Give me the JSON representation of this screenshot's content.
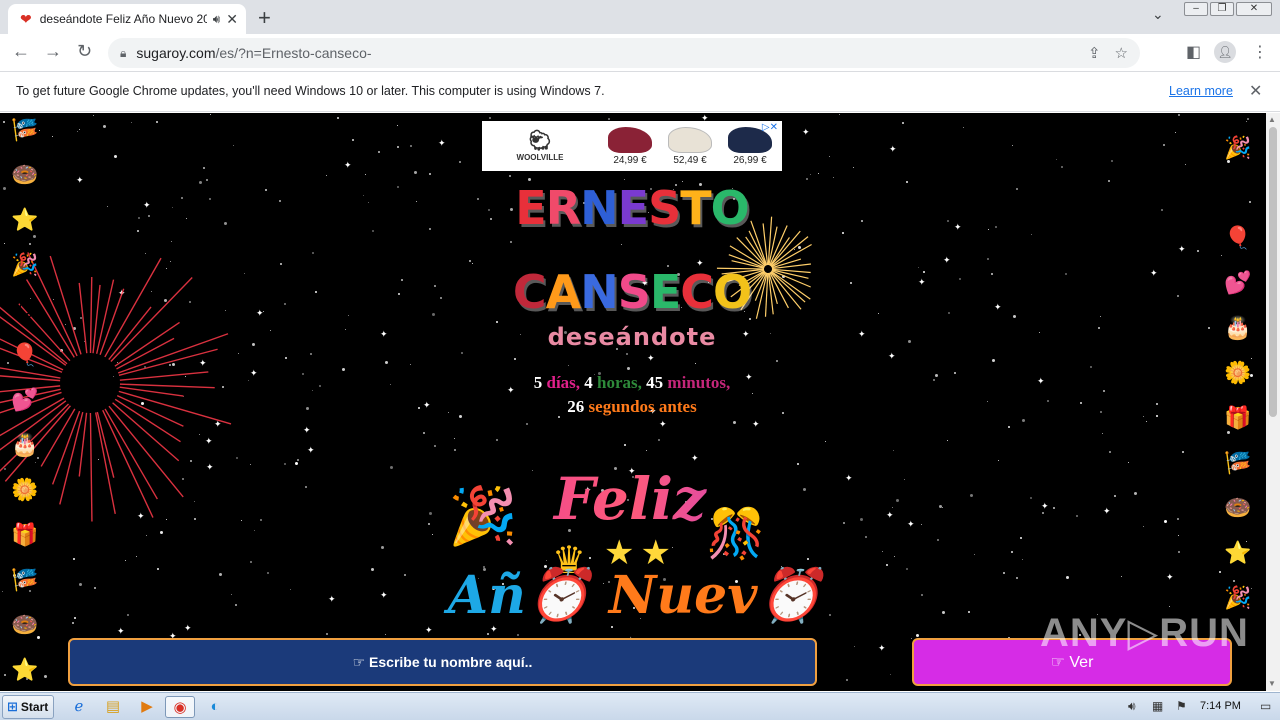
{
  "browser": {
    "tab_title": "deseándote Feliz Año Nuevo 20",
    "new_tab": "+",
    "url_host": "sugaroy.com",
    "url_path": "/es/?n=Ernesto-canseco-"
  },
  "infobar": {
    "message": "To get future Google Chrome updates, you'll need Windows 10 or later. This computer is using Windows 7.",
    "link": "Learn more"
  },
  "ad": {
    "brand": "WOOLVILLE",
    "prices": [
      "24,99 €",
      "52,49 €",
      "26,99 €"
    ]
  },
  "greeting": {
    "first_name_letters": [
      "E",
      "R",
      "N",
      "E",
      "S",
      "T",
      "O"
    ],
    "last_name_letters": [
      "C",
      "A",
      "N",
      "S",
      "E",
      "C",
      "O"
    ],
    "wishing": "deseándote",
    "countdown": {
      "days_value": "5",
      "days_label": "días,",
      "hours_value": "4",
      "hours_label": "horas,",
      "minutes_value": "45",
      "minutes_label": "minutos,",
      "seconds_value": "26",
      "seconds_label": "segundos antes"
    },
    "banner_line1": "Feliz",
    "banner_line2_a": "Añ",
    "banner_line2_b": "Nuev"
  },
  "cta": {
    "input_label": "☞ Escribe tu nombre aquí..",
    "button_label": "☞ Ver"
  },
  "watermark": "ANY▷RUN",
  "taskbar": {
    "start": "Start",
    "clock": "7:14 PM"
  },
  "colors": {
    "page_bg": "#000000",
    "cta_input_bg": "#1b3a7a",
    "cta_button_bg": "#d62ce6",
    "cta_border": "#f0a040",
    "days_label": "#e0208a",
    "hours_label": "#2e8b3a",
    "minutes_label": "#c4267a",
    "seconds_label": "#ff7a1a"
  },
  "icons": {
    "left_column": [
      "bunting",
      "donut",
      "star",
      "party-popper",
      "smiley",
      "balloons",
      "hearts",
      "cake",
      "plant",
      "gift",
      "bunting",
      "donut",
      "star"
    ],
    "right_column": [
      "party-popper",
      "smiley",
      "balloons",
      "hearts",
      "cake",
      "plant",
      "gift",
      "bunting",
      "donut",
      "star",
      "party-popper",
      "smiley"
    ]
  }
}
